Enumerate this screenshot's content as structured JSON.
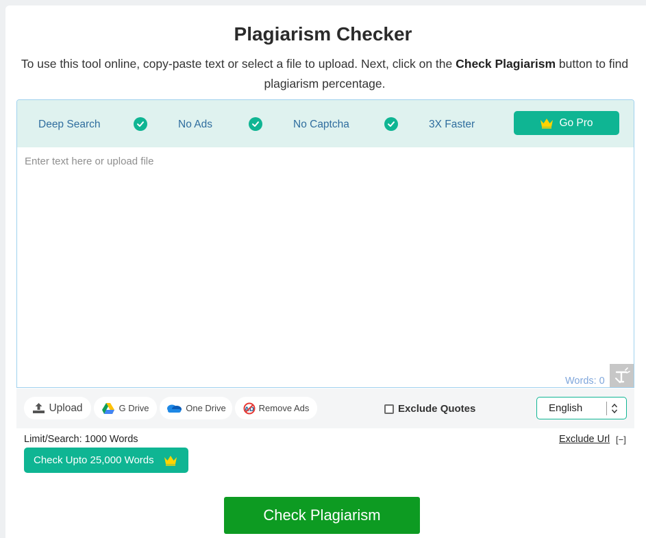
{
  "header": {
    "title": "Plagiarism Checker",
    "intro_before": "To use this tool online, copy-paste text or select a file to upload. Next, click on the ",
    "intro_bold": "Check Plagiarism",
    "intro_after": " button to find plagiarism percentage."
  },
  "features": {
    "items": [
      "Deep Search",
      "No Ads",
      "No Captcha",
      "3X Faster"
    ],
    "go_pro_label": "Go Pro"
  },
  "editor": {
    "placeholder": "Enter text here or upload file",
    "words_label": "Words:",
    "words_count": "0"
  },
  "toolbar": {
    "upload_label": "Upload",
    "gdrive_label": "G Drive",
    "onedrive_label": "One Drive",
    "remove_ads_label": "Remove Ads",
    "exclude_quotes_label": "Exclude Quotes",
    "language_selected": "English"
  },
  "limits": {
    "limit_text": "Limit/Search: 1000 Words",
    "upgrade_label": "Check Upto 25,000 Words",
    "exclude_url_label": "Exclude Url",
    "collapse_label": "[−]"
  },
  "actions": {
    "check_label": "Check Plagiarism"
  },
  "colors": {
    "accent": "#0fb593",
    "feature_bar": "#dff2ef",
    "feature_text": "#2f6d9e",
    "check_button": "#0d9b22",
    "crown": "#ffd400"
  }
}
